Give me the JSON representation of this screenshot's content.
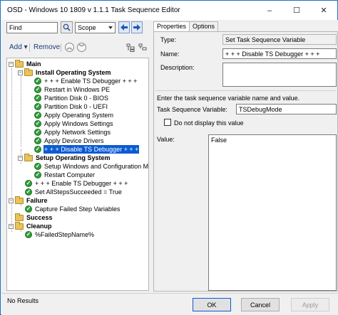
{
  "window": {
    "title": "OSD - Windows 10 1809 v 1.1.1 Task Sequence Editor",
    "minimize": "–",
    "maximize": "☐",
    "close": "✕"
  },
  "search": {
    "value": "Find",
    "scope": "Scope"
  },
  "toolbar": {
    "add_label": "Add",
    "remove_label": "Remove"
  },
  "tree": {
    "items": [
      {
        "label": "Main"
      },
      {
        "label": "Install Operating System"
      },
      {
        "label": "+ + + Enable TS Debugger + + +"
      },
      {
        "label": "Restart in Windows PE"
      },
      {
        "label": "Partition Disk 0 - BIOS"
      },
      {
        "label": "Partition Disk 0 - UEFI"
      },
      {
        "label": "Apply Operating System"
      },
      {
        "label": "Apply Windows Settings"
      },
      {
        "label": "Apply Network Settings"
      },
      {
        "label": "Apply Device Drivers"
      },
      {
        "label": "+ + + Disable TS Debugger + + +"
      },
      {
        "label": "Setup Operating System"
      },
      {
        "label": "Setup Windows and Configuration Man"
      },
      {
        "label": "Restart Computer"
      },
      {
        "label": "+ + + Enable TS Debugger + + +"
      },
      {
        "label": "Set AllStepsSucceeded = True"
      },
      {
        "label": "Failure"
      },
      {
        "label": "Capture Failed Step Variables"
      },
      {
        "label": "Success"
      },
      {
        "label": "Cleanup"
      },
      {
        "label": "%FailedStepName%"
      }
    ]
  },
  "tabs": {
    "properties": "Properties",
    "options": "Options"
  },
  "properties": {
    "type_label": "Type:",
    "type_value": "Set Task Sequence Variable",
    "name_label": "Name:",
    "name_value": "+ + + Disable TS Debugger + + +",
    "description_label": "Description:",
    "description_value": "",
    "instruction": "Enter the task sequence variable name and value.",
    "variable_label": "Task Sequence Variable:",
    "variable_value": "TSDebugMode",
    "donotdisplay_label": "Do not display this value",
    "value_label": "Value:",
    "value_value": "False"
  },
  "status": {
    "text": "No Results"
  },
  "buttons": {
    "ok": "OK",
    "cancel": "Cancel",
    "apply": "Apply"
  },
  "colors": {
    "accent": "#0b5bd3",
    "check": "#2e9e3a",
    "folder": "#e8c35a"
  }
}
